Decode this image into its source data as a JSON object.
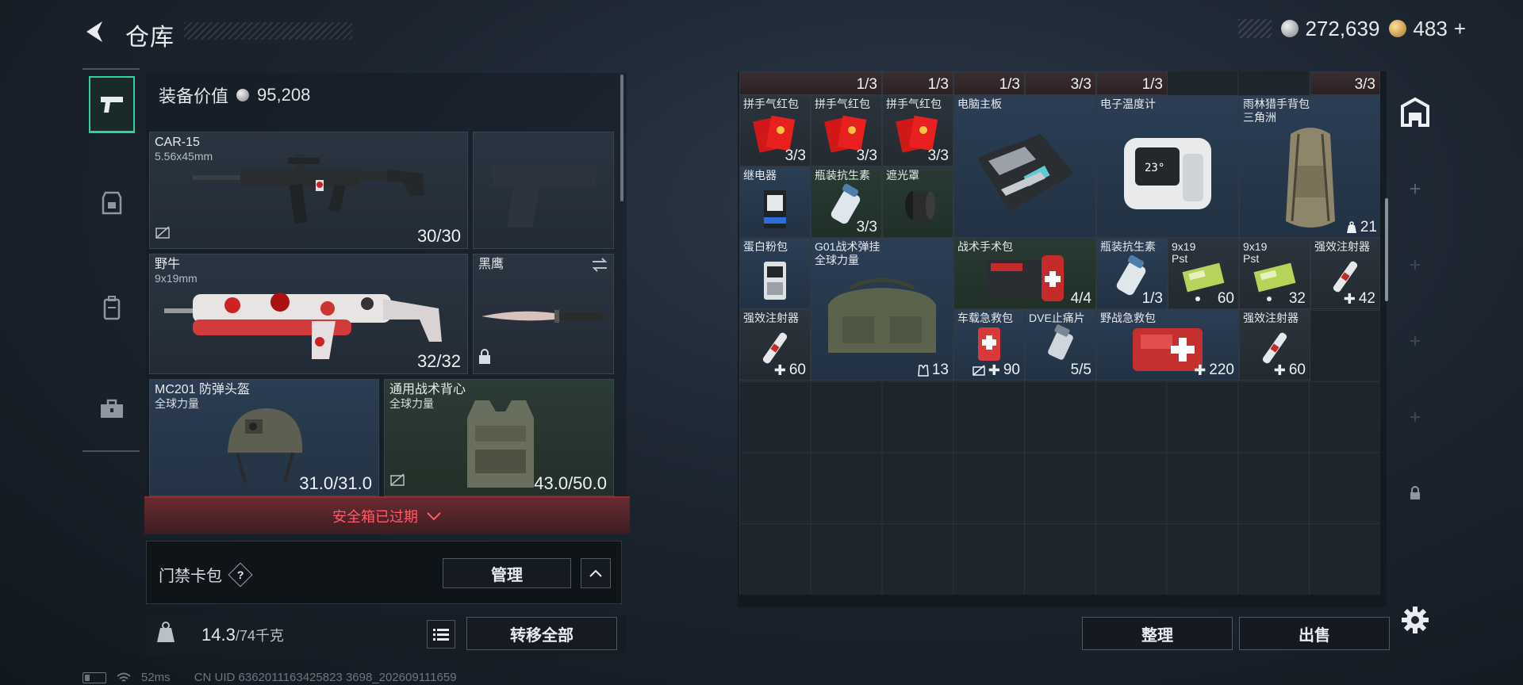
{
  "header": {
    "title": "仓库",
    "currency_silver": "272,639",
    "currency_gold": "483",
    "currency_add": "+"
  },
  "left_nav": {
    "tabs": [
      "weapon-tab",
      "armor-tab",
      "backpack-tab",
      "toolbox-tab"
    ]
  },
  "equipment": {
    "value_label": "装备价值",
    "value": "95,208",
    "primary_weapon": {
      "name": "CAR-15",
      "caliber": "5.56x45mm",
      "ammo": "30/30"
    },
    "secondary_weapon": {
      "name": "野牛",
      "caliber": "9x19mm",
      "ammo": "32/32"
    },
    "melee": {
      "name": "黑鹰"
    },
    "helmet": {
      "name": "MC201 防弹头盔",
      "brand": "全球力量",
      "durability": "31.0/31.0"
    },
    "vest": {
      "name": "通用战术背心",
      "brand": "全球力量",
      "durability": "43.0/50.0"
    },
    "safe_box_status": "安全箱已过期",
    "card_pack_label": "门禁卡包",
    "card_pack_help": "?",
    "manage_label": "管理",
    "weight_current": "14.3",
    "weight_max": "/74千克",
    "transfer_all_label": "转移全部"
  },
  "status_bar": {
    "ping": "52ms",
    "uid": "CN UID 6362011163425823 3698_202609111659"
  },
  "warehouse": {
    "top_row_counts": [
      "1/3",
      "1/3",
      "1/3",
      "3/3",
      "1/3",
      "3/3"
    ],
    "items": [
      {
        "name": "拼手气红包",
        "count": "3/3"
      },
      {
        "name": "拼手气红包",
        "count": "3/3"
      },
      {
        "name": "拼手气红包",
        "count": "3/3"
      },
      {
        "name": "电脑主板",
        "count": ""
      },
      {
        "name": "电子温度计",
        "count": ""
      },
      {
        "name": "雨林猎手背包",
        "sub": "三角洲",
        "count": "21"
      },
      {
        "name": "继电器",
        "count": ""
      },
      {
        "name": "瓶装抗生素",
        "count": "3/3"
      },
      {
        "name": "遮光罩",
        "count": ""
      },
      {
        "name": "蛋白粉包",
        "count": ""
      },
      {
        "name": "G01战术弹挂",
        "sub": "全球力量",
        "count": "13"
      },
      {
        "name": "战术手术包",
        "count": "4/4"
      },
      {
        "name": "瓶装抗生素",
        "count": "1/3"
      },
      {
        "name": "9x19",
        "sub": "Pst",
        "count": "60"
      },
      {
        "name": "9x19",
        "sub": "Pst",
        "count": "32"
      },
      {
        "name": "强效注射器",
        "count": "42"
      },
      {
        "name": "强效注射器",
        "count": "60"
      },
      {
        "name": "车载急救包",
        "count": "90"
      },
      {
        "name": "DVE止痛片",
        "count": "5/5"
      },
      {
        "name": "野战急救包",
        "count": "220"
      },
      {
        "name": "强效注射器",
        "count": "60"
      }
    ],
    "sort_label": "整理",
    "sell_label": "出售"
  },
  "colors": {
    "accent_green": "#2fd39a",
    "alert_red": "#ff5c66"
  }
}
